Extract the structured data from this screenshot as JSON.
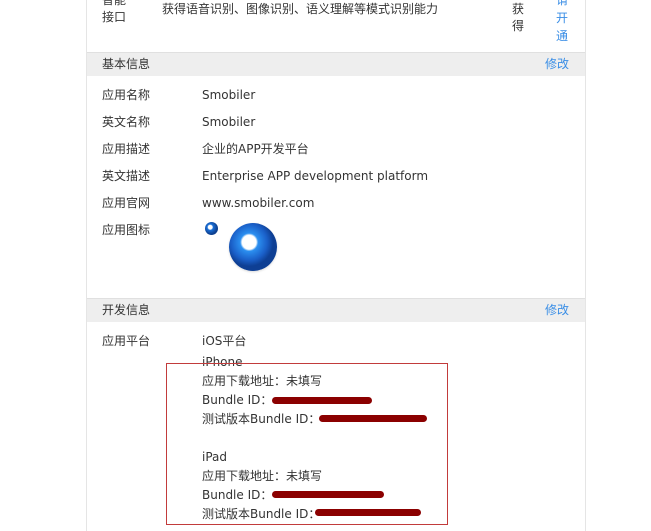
{
  "top_row": {
    "label_line1": "智能",
    "label_line2": "接口",
    "desc": "获得语音识别、图像识别、语义理解等模式识别能力",
    "status_line1": "获",
    "status_line2": "得",
    "action_line1": "请",
    "action_line2": "开",
    "action_line3": "通"
  },
  "basic_info": {
    "title": "基本信息",
    "edit": "修改",
    "rows": [
      {
        "label": "应用名称",
        "value": "Smobiler"
      },
      {
        "label": "英文名称",
        "value": "Smobiler"
      },
      {
        "label": "应用描述",
        "value": "企业的APP开发平台"
      },
      {
        "label": "英文描述",
        "value": "Enterprise APP development platform"
      },
      {
        "label": "应用官网",
        "value": "www.smobiler.com"
      },
      {
        "label": "应用图标",
        "value": ""
      }
    ]
  },
  "dev_info": {
    "title": "开发信息",
    "edit": "修改",
    "platform_label": "应用平台",
    "ios_title": "iOS平台",
    "iphone": {
      "title": "iPhone",
      "download": "应用下载地址：未填写",
      "bundle": "Bundle ID：",
      "test_bundle": "测试版本Bundle ID："
    },
    "ipad": {
      "title": "iPad",
      "download": "应用下载地址：未填写",
      "bundle": "Bundle ID：",
      "test_bundle": "测试版本Bundle ID："
    }
  },
  "colors": {
    "link": "#3a8ee6",
    "section_bg": "#eeeeee",
    "highlight_box": "#c23b3b",
    "redaction": "#8b0000"
  },
  "icons": [
    "app-icon-small",
    "app-icon-large"
  ]
}
